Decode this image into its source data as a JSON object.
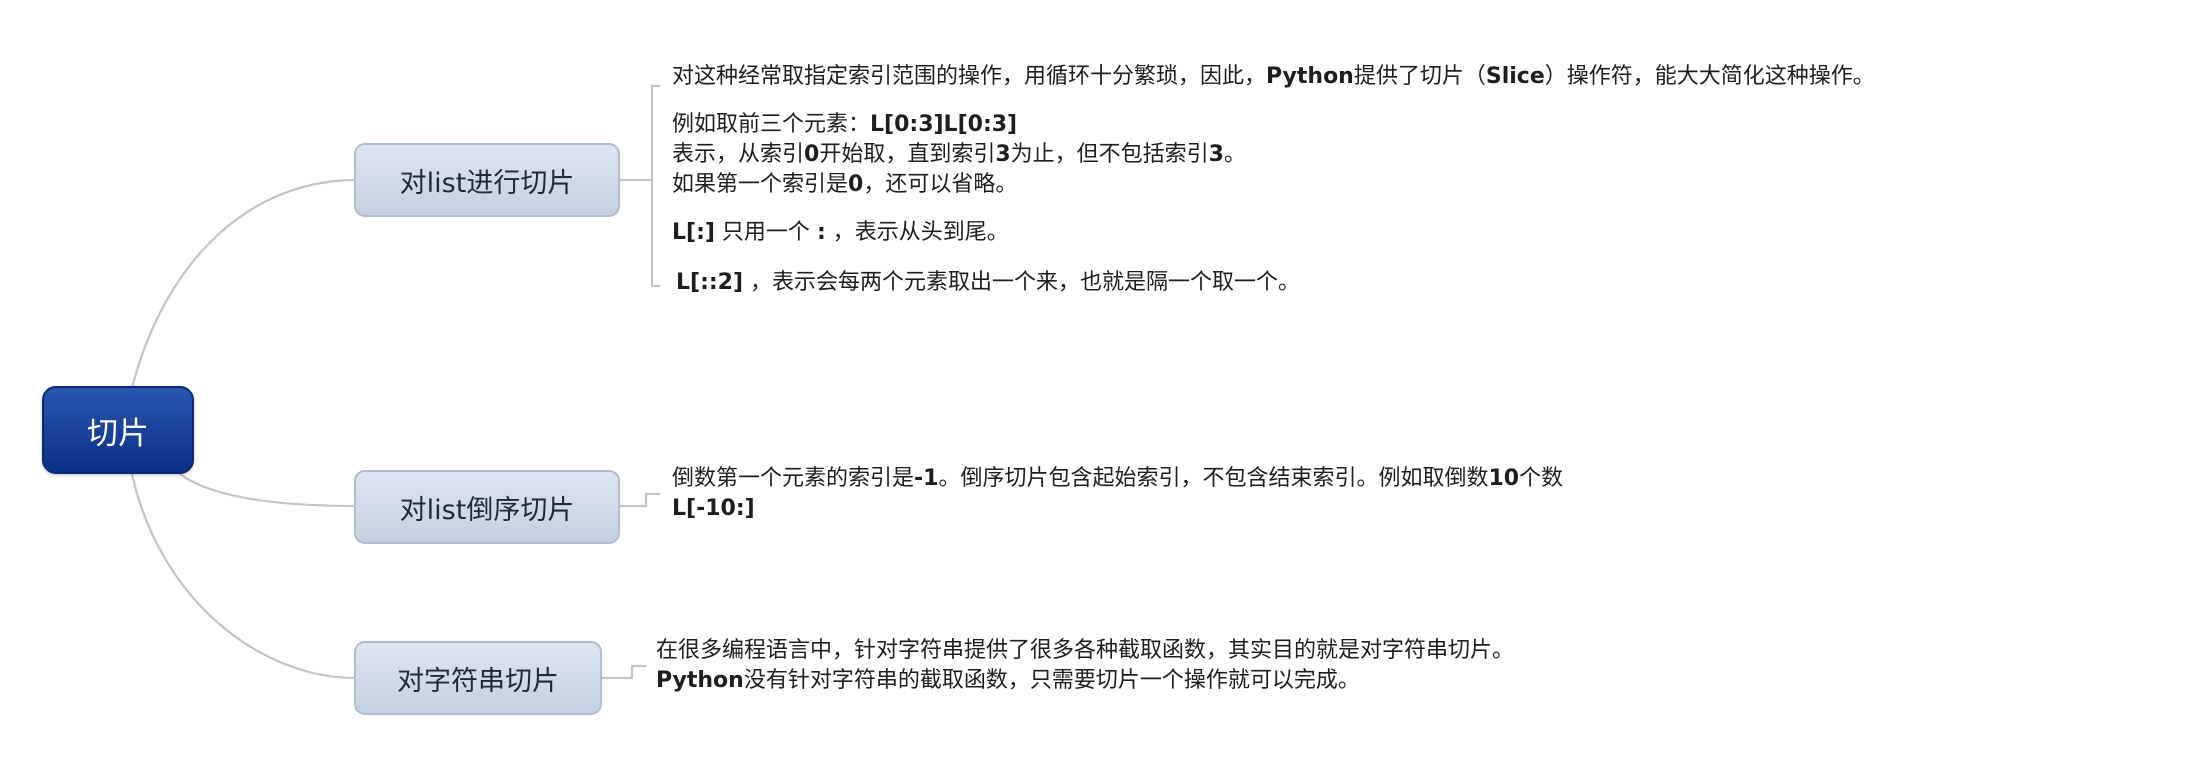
{
  "root": {
    "label": "切片"
  },
  "branches": [
    {
      "label": "对list进行切片",
      "notes": [
        {
          "lines": [
            [
              {
                "t": "对这种经常取指定索引范围的操作，用循环十分繁琐，因此，"
              },
              {
                "t": "Python",
                "b": true
              },
              {
                "t": "提供了切片（"
              },
              {
                "t": "Slice",
                "b": true
              },
              {
                "t": "）操作符，能大大简化这种操作。"
              }
            ]
          ]
        },
        {
          "lines": [
            [
              {
                "t": "例如取前三个元素："
              },
              {
                "t": "L[0:3]L[0:3]",
                "b": true
              }
            ],
            [
              {
                "t": "表示，从索引"
              },
              {
                "t": "0",
                "b": true
              },
              {
                "t": "开始取，直到索引"
              },
              {
                "t": "3",
                "b": true
              },
              {
                "t": "为止，但不包括索引"
              },
              {
                "t": "3",
                "b": true
              },
              {
                "t": "。"
              }
            ],
            [
              {
                "t": "如果第一个索引是"
              },
              {
                "t": "0",
                "b": true
              },
              {
                "t": "，还可以省略。"
              }
            ]
          ]
        },
        {
          "lines": [
            [
              {
                "t": "L[:]",
                "b": true
              },
              {
                "t": "  只用一个 "
              },
              {
                "t": ":",
                "b": true
              },
              {
                "t": " ，表示从头到尾。"
              }
            ]
          ]
        },
        {
          "lines": [
            [
              {
                "t": "L[::2]",
                "b": true
              },
              {
                "t": " ，表示会每两个元素取出一个来，也就是隔一个取一个。"
              }
            ]
          ]
        }
      ]
    },
    {
      "label": "对list倒序切片",
      "notes": [
        {
          "lines": [
            [
              {
                "t": "倒数第一个元素的索引是"
              },
              {
                "t": "-1",
                "b": true
              },
              {
                "t": "。倒序切片包含起始索引，不包含结束索引。例如取倒数"
              },
              {
                "t": "10",
                "b": true
              },
              {
                "t": "个数"
              }
            ],
            [
              {
                "t": "L[-10:]",
                "b": true
              }
            ]
          ]
        }
      ]
    },
    {
      "label": "对字符串切片",
      "notes": [
        {
          "lines": [
            [
              {
                "t": "在很多编程语言中，针对字符串提供了很多各种截取函数，其实目的就是对字符串切片。"
              }
            ],
            [
              {
                "t": "Python",
                "b": true
              },
              {
                "t": "没有针对字符串的截取函数，只需要切片一个操作就可以完成。"
              }
            ]
          ]
        }
      ]
    }
  ],
  "colors": {
    "root_fill": "#0b2f86",
    "branch_fill": "#c9d6e4",
    "connector": "#c4c4c4",
    "text": "#1e1e1e"
  }
}
